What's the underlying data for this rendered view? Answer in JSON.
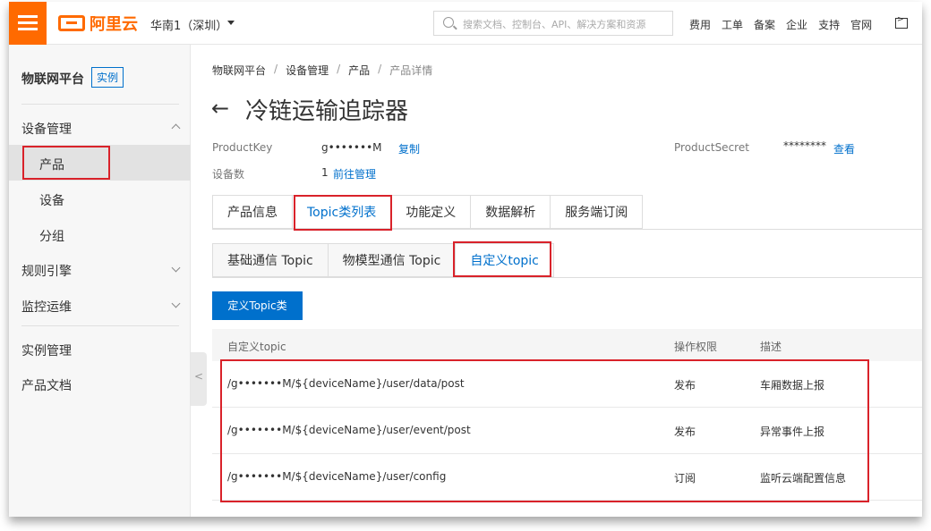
{
  "topbar": {
    "brand": "阿里云",
    "region": "华南1（深圳）",
    "search_placeholder": "搜索文档、控制台、API、解决方案和资源",
    "nav": [
      "费用",
      "工单",
      "备案",
      "企业",
      "支持",
      "官网"
    ]
  },
  "sidebar": {
    "title": "物联网平台",
    "badge": "实例",
    "group": "设备管理",
    "subitems": [
      "产品",
      "设备",
      "分组"
    ],
    "items": [
      "规则引擎",
      "监控运维"
    ],
    "bottom": [
      "实例管理",
      "产品文档"
    ]
  },
  "breadcrumb": [
    "物联网平台",
    "设备管理",
    "产品",
    "产品详情"
  ],
  "page": {
    "title": "冷链运输追踪器",
    "product_key_label": "ProductKey",
    "product_key_value": "g•••••••M",
    "copy_link": "复制",
    "device_count_label": "设备数",
    "device_count_value": "1",
    "manage_link": "前往管理",
    "product_secret_label": "ProductSecret",
    "product_secret_value": "********",
    "view_link": "查看"
  },
  "tabs": [
    "产品信息",
    "Topic类列表",
    "功能定义",
    "数据解析",
    "服务端订阅"
  ],
  "subtabs": [
    "基础通信 Topic",
    "物模型通信 Topic",
    "自定义topic"
  ],
  "define_button": "定义Topic类",
  "table": {
    "headers": [
      "自定义topic",
      "操作权限",
      "描述"
    ],
    "rows": [
      {
        "topic": "/g•••••••M/${deviceName}/user/data/post",
        "perm": "发布",
        "desc": "车厢数据上报"
      },
      {
        "topic": "/g•••••••M/${deviceName}/user/event/post",
        "perm": "发布",
        "desc": "异常事件上报"
      },
      {
        "topic": "/g•••••••M/${deviceName}/user/config",
        "perm": "订阅",
        "desc": "监听云端配置信息"
      }
    ]
  },
  "colors": {
    "accent": "#ff6a00",
    "primary": "#0070cc",
    "highlight": "#d9222a"
  }
}
